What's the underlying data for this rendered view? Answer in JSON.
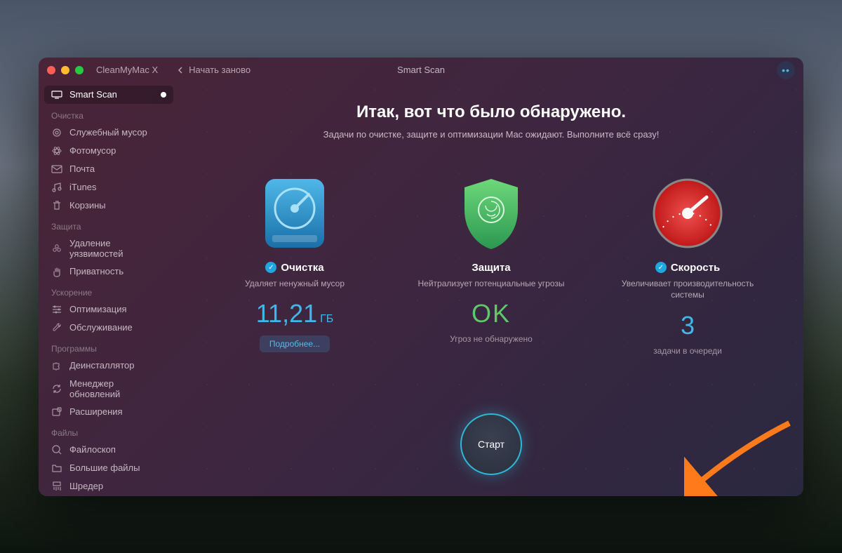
{
  "titlebar": {
    "app_title": "CleanMyMac X",
    "restart_label": "Начать заново",
    "window_title": "Smart Scan"
  },
  "sidebar": {
    "smart_scan": "Smart Scan",
    "sections": {
      "cleaning": "Очистка",
      "protection": "Защита",
      "speed": "Ускорение",
      "apps": "Программы",
      "files": "Файлы"
    },
    "items": {
      "system_junk": "Служебный мусор",
      "photo_junk": "Фотомусор",
      "mail": "Почта",
      "itunes": "iTunes",
      "trash": "Корзины",
      "malware": "Удаление уязвимостей",
      "privacy": "Приватность",
      "optimization": "Оптимизация",
      "maintenance": "Обслуживание",
      "uninstaller": "Деинсталлятор",
      "updater": "Менеджер обновлений",
      "extensions": "Расширения",
      "space_lens": "Файлоскоп",
      "large_files": "Большие файлы",
      "shredder": "Шредер"
    }
  },
  "main": {
    "headline": "Итак, вот что было обнаружено.",
    "subline": "Задачи по очистке, защите и оптимизации Mac ожидают. Выполните всё сразу!",
    "cards": {
      "cleanup": {
        "title": "Очистка",
        "desc": "Удаляет ненужный мусор",
        "value": "11,21",
        "unit": "ГБ",
        "more": "Подробнее..."
      },
      "protection": {
        "title": "Защита",
        "desc": "Нейтрализует потенциальные угрозы",
        "value": "OK",
        "status": "Угроз не обнаружено"
      },
      "speed": {
        "title": "Скорость",
        "desc": "Увеличивает производительность системы",
        "value": "3",
        "status": "задачи в очереди"
      }
    },
    "start_button": "Старт"
  }
}
